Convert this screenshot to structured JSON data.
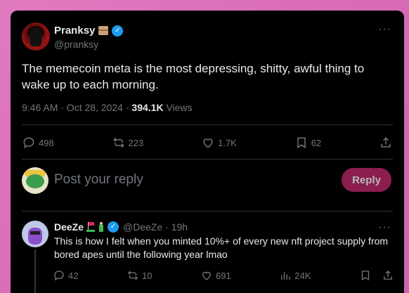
{
  "tweet": {
    "author_name": "Pranksy",
    "author_handle": "@pranksy",
    "text": "The memecoin meta is the most depressing, shitty, awful thing to wake up to each morning.",
    "time": "9:46 AM · Oct 28, 2024 · ",
    "views_count": "394.1K",
    "views_label": " Views",
    "more": "···",
    "stats": {
      "replies": "498",
      "reposts": "223",
      "likes": "1.7K",
      "bookmarks": "62"
    }
  },
  "composer": {
    "placeholder": "Post your reply",
    "reply_button": "Reply"
  },
  "reply": {
    "author_name": "DeeZe",
    "author_handle": "@DeeZe · 19h",
    "text": "This is how I felt when you minted 10%+ of every new nft project supply from bored apes until the following year lmao",
    "more": "···",
    "stats": {
      "replies": "42",
      "reposts": "10",
      "likes": "691",
      "views": "24K"
    }
  },
  "colors": {
    "background": "#d96bb8",
    "card": "#000000",
    "verified": "#1d9bf0",
    "reply_button": "#8b1d4f",
    "muted": "#71767b"
  }
}
